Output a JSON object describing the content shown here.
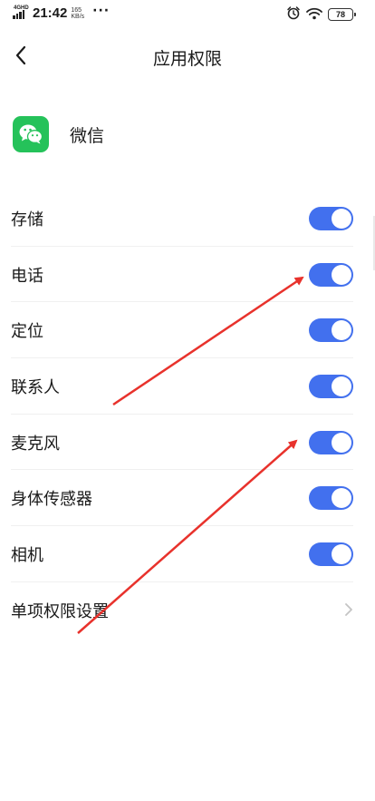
{
  "status_bar": {
    "network": "4G",
    "hd": "HD",
    "time": "21:42",
    "speed_value": "165",
    "speed_unit": "KB/s",
    "more": "···",
    "battery": "78"
  },
  "header": {
    "title": "应用权限",
    "back_icon": "chevron-left-icon"
  },
  "app": {
    "name": "微信",
    "icon": "wechat-icon"
  },
  "permissions": [
    {
      "label": "存储",
      "enabled": true
    },
    {
      "label": "电话",
      "enabled": true
    },
    {
      "label": "定位",
      "enabled": true
    },
    {
      "label": "联系人",
      "enabled": true
    },
    {
      "label": "麦克风",
      "enabled": true
    },
    {
      "label": "身体传感器",
      "enabled": true
    },
    {
      "label": "相机",
      "enabled": true
    }
  ],
  "individual_settings": {
    "label": "单项权限设置",
    "icon": "chevron-right-icon"
  },
  "colors": {
    "toggle_on": "#4270ee",
    "wechat_green": "#25c25a",
    "annotation_arrow": "#e8322c"
  }
}
